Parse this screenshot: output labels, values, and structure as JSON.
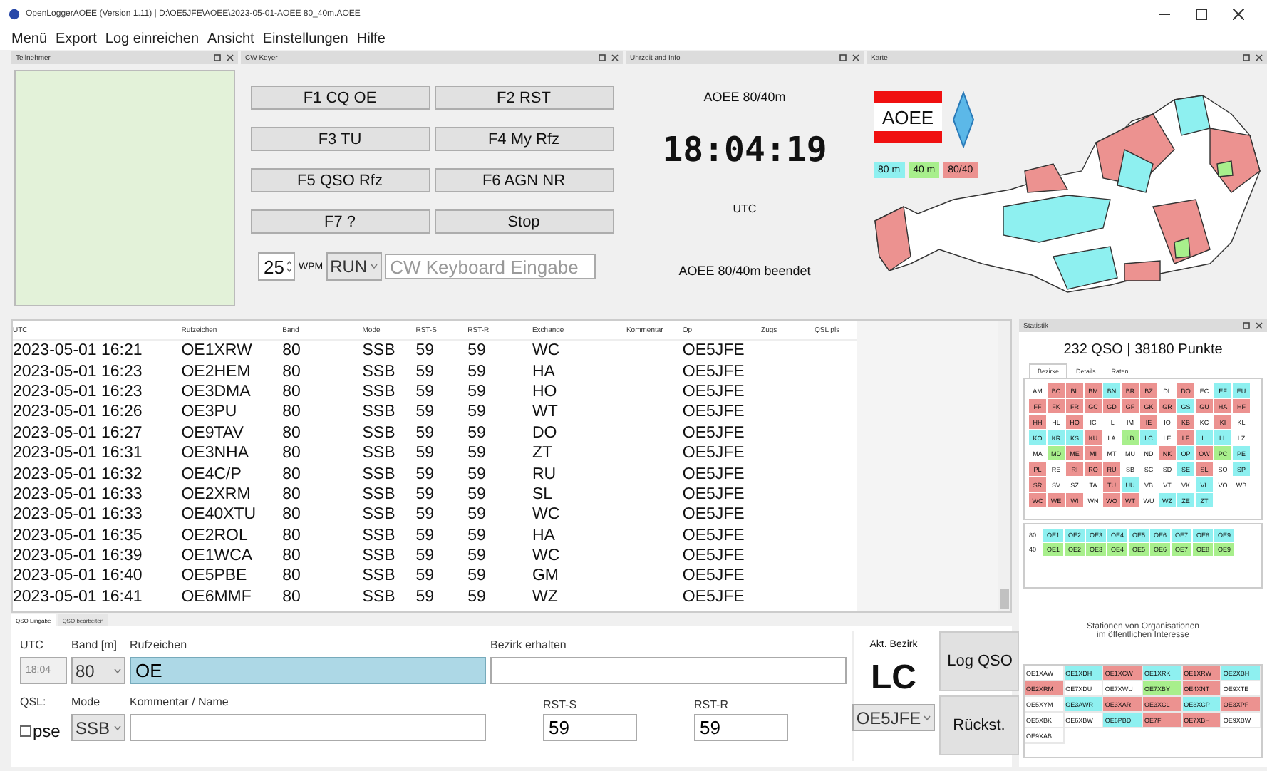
{
  "window": {
    "title": "OpenLoggerAOEE (Version 1.11) | D:\\OE5JFE\\AOEE\\2023-05-01-AOEE 80_40m.AOEE"
  },
  "menu": [
    "Menü",
    "Export",
    "Log einreichen",
    "Ansicht",
    "Einstellungen",
    "Hilfe"
  ],
  "participants_panel": {
    "title": "Teilnehmer"
  },
  "cw_keyer": {
    "title": "CW Keyer",
    "buttons": [
      "F1 CQ OE",
      "F2 RST",
      "F3 TU",
      "F4 My Rfz",
      "F5 QSO Rfz",
      "F6 AGN NR",
      "F7 ?",
      "Stop"
    ],
    "wpm": "25",
    "wpm_label": "WPM",
    "mode": "RUN",
    "placeholder": "CW Keyboard Eingabe"
  },
  "clock": {
    "title": "Uhrzeit and Info",
    "contest": "AOEE 80/40m",
    "time": "18:04:19",
    "zone": "UTC",
    "status": "AOEE 80/40m beendet"
  },
  "map": {
    "title": "Karte",
    "logo": "AOEE",
    "legend": [
      {
        "label": "80 m",
        "color": "#8ef0f0"
      },
      {
        "label": "40 m",
        "color": "#a8ef8c"
      },
      {
        "label": "80/40",
        "color": "#ec9290"
      }
    ]
  },
  "log_table": {
    "columns": [
      "UTC",
      "Rufzeichen",
      "Band",
      "Mode",
      "RST-S",
      "RST-R",
      "Exchange",
      "Kommentar",
      "Op",
      "Zugs",
      "QSL pls"
    ],
    "rows": [
      [
        "2023-05-01 16:21",
        "OE1XRW",
        "80",
        "SSB",
        "59",
        "59",
        "WC",
        "",
        "OE5JFE",
        "",
        ""
      ],
      [
        "2023-05-01 16:23",
        "OE2HEM",
        "80",
        "SSB",
        "59",
        "59",
        "HA",
        "",
        "OE5JFE",
        "",
        ""
      ],
      [
        "2023-05-01 16:23",
        "OE3DMA",
        "80",
        "SSB",
        "59",
        "59",
        "HO",
        "",
        "OE5JFE",
        "",
        ""
      ],
      [
        "2023-05-01 16:26",
        "OE3PU",
        "80",
        "SSB",
        "59",
        "59",
        "WT",
        "",
        "OE5JFE",
        "",
        ""
      ],
      [
        "2023-05-01 16:27",
        "OE9TAV",
        "80",
        "SSB",
        "59",
        "59",
        "DO",
        "",
        "OE5JFE",
        "",
        ""
      ],
      [
        "2023-05-01 16:31",
        "OE3NHA",
        "80",
        "SSB",
        "59",
        "59",
        "ZT",
        "",
        "OE5JFE",
        "",
        ""
      ],
      [
        "2023-05-01 16:32",
        "OE4C/P",
        "80",
        "SSB",
        "59",
        "59",
        "RU",
        "",
        "OE5JFE",
        "",
        ""
      ],
      [
        "2023-05-01 16:33",
        "OE2XRM",
        "80",
        "SSB",
        "59",
        "59",
        "SL",
        "",
        "OE5JFE",
        "",
        ""
      ],
      [
        "2023-05-01 16:33",
        "OE40XTU",
        "80",
        "SSB",
        "59",
        "59",
        "WC",
        "",
        "OE5JFE",
        "",
        ""
      ],
      [
        "2023-05-01 16:35",
        "OE2ROL",
        "80",
        "SSB",
        "59",
        "59",
        "HA",
        "",
        "OE5JFE",
        "",
        ""
      ],
      [
        "2023-05-01 16:39",
        "OE1WCA",
        "80",
        "SSB",
        "59",
        "59",
        "WC",
        "",
        "OE5JFE",
        "",
        ""
      ],
      [
        "2023-05-01 16:40",
        "OE5PBE",
        "80",
        "SSB",
        "59",
        "59",
        "GM",
        "",
        "OE5JFE",
        "",
        ""
      ],
      [
        "2023-05-01 16:41",
        "OE6MMF",
        "80",
        "SSB",
        "59",
        "59",
        "WZ",
        "",
        "OE5JFE",
        "",
        ""
      ]
    ]
  },
  "entry": {
    "tabs": [
      {
        "label": "QSO Eingabe",
        "selected": true
      },
      {
        "label": "QSO bearbeiten",
        "selected": false
      }
    ],
    "utc_label": "UTC",
    "utc_value": "18:04",
    "band_label": "Band [m]",
    "band_value": "80",
    "call_label": "Rufzeichen",
    "call_value": "OE",
    "district_label": "Bezirk erhalten",
    "qsl_label": "QSL:",
    "qsl_checkbox": {
      "label": "pse",
      "checked": false
    },
    "mode_label": "Mode",
    "mode_value": "SSB",
    "comment_label": "Kommentar / Name",
    "rsts_label": "RST-S",
    "rsts_value": "59",
    "rstr_label": "RST-R",
    "rstr_value": "59",
    "current_label": "Akt. Bezirk",
    "current_value": "LC",
    "operator": "OE5JFE",
    "log_button": "Log QSO",
    "reset_button": "Rückst."
  },
  "statistics": {
    "title": "Statistik",
    "summary": "232 QSO | 38180 Punkte",
    "tabs": [
      {
        "label": "Bezirke",
        "selected": true
      },
      {
        "label": "Details",
        "selected": false
      },
      {
        "label": "Raten",
        "selected": false
      }
    ],
    "districts": [
      {
        "code": "AM",
        "color": "#ffffff"
      },
      {
        "code": "BC",
        "color": "#ec9290"
      },
      {
        "code": "BL",
        "color": "#ec9290"
      },
      {
        "code": "BM",
        "color": "#ec9290"
      },
      {
        "code": "BN",
        "color": "#8ef0f0"
      },
      {
        "code": "BR",
        "color": "#ec9290"
      },
      {
        "code": "BZ",
        "color": "#ec9290"
      },
      {
        "code": "DL",
        "color": "#ffffff"
      },
      {
        "code": "DO",
        "color": "#ec9290"
      },
      {
        "code": "EC",
        "color": "#ffffff"
      },
      {
        "code": "EF",
        "color": "#8ef0f0"
      },
      {
        "code": "EU",
        "color": "#8ef0f0"
      },
      {
        "code": "FF",
        "color": "#ec9290"
      },
      {
        "code": "FK",
        "color": "#ec9290"
      },
      {
        "code": "FR",
        "color": "#ec9290"
      },
      {
        "code": "GC",
        "color": "#ec9290"
      },
      {
        "code": "GD",
        "color": "#ec9290"
      },
      {
        "code": "GF",
        "color": "#ec9290"
      },
      {
        "code": "GK",
        "color": "#ec9290"
      },
      {
        "code": "GR",
        "color": "#ec9290"
      },
      {
        "code": "GS",
        "color": "#8ef0f0"
      },
      {
        "code": "GU",
        "color": "#ec9290"
      },
      {
        "code": "HA",
        "color": "#ec9290"
      },
      {
        "code": "HF",
        "color": "#ec9290"
      },
      {
        "code": "HH",
        "color": "#ec9290"
      },
      {
        "code": "HL",
        "color": "#ffffff"
      },
      {
        "code": "HO",
        "color": "#ec9290"
      },
      {
        "code": "IC",
        "color": "#ffffff"
      },
      {
        "code": "IL",
        "color": "#ffffff"
      },
      {
        "code": "IM",
        "color": "#ffffff"
      },
      {
        "code": "IE",
        "color": "#ec9290"
      },
      {
        "code": "IO",
        "color": "#ffffff"
      },
      {
        "code": "KB",
        "color": "#ec9290"
      },
      {
        "code": "KC",
        "color": "#ffffff"
      },
      {
        "code": "KI",
        "color": "#ec9290"
      },
      {
        "code": "KL",
        "color": "#ffffff"
      },
      {
        "code": "KO",
        "color": "#8ef0f0"
      },
      {
        "code": "KR",
        "color": "#8ef0f0"
      },
      {
        "code": "KS",
        "color": "#8ef0f0"
      },
      {
        "code": "KU",
        "color": "#ec9290"
      },
      {
        "code": "LA",
        "color": "#ffffff"
      },
      {
        "code": "LB",
        "color": "#a8ef8c"
      },
      {
        "code": "LC",
        "color": "#8ef0f0"
      },
      {
        "code": "LE",
        "color": "#ffffff"
      },
      {
        "code": "LF",
        "color": "#ec9290"
      },
      {
        "code": "LI",
        "color": "#8ef0f0"
      },
      {
        "code": "LL",
        "color": "#8ef0f0"
      },
      {
        "code": "LZ",
        "color": "#ffffff"
      },
      {
        "code": "MA",
        "color": "#ffffff"
      },
      {
        "code": "MD",
        "color": "#a8ef8c"
      },
      {
        "code": "ME",
        "color": "#ec9290"
      },
      {
        "code": "MI",
        "color": "#ec9290"
      },
      {
        "code": "MT",
        "color": "#ffffff"
      },
      {
        "code": "MU",
        "color": "#ffffff"
      },
      {
        "code": "ND",
        "color": "#ffffff"
      },
      {
        "code": "NK",
        "color": "#ec9290"
      },
      {
        "code": "OP",
        "color": "#8ef0f0"
      },
      {
        "code": "OW",
        "color": "#ec9290"
      },
      {
        "code": "PC",
        "color": "#a8ef8c"
      },
      {
        "code": "PE",
        "color": "#8ef0f0"
      },
      {
        "code": "PL",
        "color": "#ec9290"
      },
      {
        "code": "RE",
        "color": "#ffffff"
      },
      {
        "code": "RI",
        "color": "#ec9290"
      },
      {
        "code": "RO",
        "color": "#ec9290"
      },
      {
        "code": "RU",
        "color": "#ec9290"
      },
      {
        "code": "SB",
        "color": "#ffffff"
      },
      {
        "code": "SC",
        "color": "#ffffff"
      },
      {
        "code": "SD",
        "color": "#ffffff"
      },
      {
        "code": "SE",
        "color": "#8ef0f0"
      },
      {
        "code": "SL",
        "color": "#ec9290"
      },
      {
        "code": "SO",
        "color": "#ffffff"
      },
      {
        "code": "SP",
        "color": "#8ef0f0"
      },
      {
        "code": "SR",
        "color": "#ec9290"
      },
      {
        "code": "SV",
        "color": "#ffffff"
      },
      {
        "code": "SZ",
        "color": "#ffffff"
      },
      {
        "code": "TA",
        "color": "#ffffff"
      },
      {
        "code": "TU",
        "color": "#ec9290"
      },
      {
        "code": "UU",
        "color": "#8ef0f0"
      },
      {
        "code": "VB",
        "color": "#ffffff"
      },
      {
        "code": "VT",
        "color": "#ffffff"
      },
      {
        "code": "VK",
        "color": "#ffffff"
      },
      {
        "code": "VL",
        "color": "#8ef0f0"
      },
      {
        "code": "VO",
        "color": "#ffffff"
      },
      {
        "code": "WB",
        "color": "#ffffff"
      },
      {
        "code": "WC",
        "color": "#ec9290"
      },
      {
        "code": "WE",
        "color": "#ec9290"
      },
      {
        "code": "WI",
        "color": "#ec9290"
      },
      {
        "code": "WN",
        "color": "#ffffff"
      },
      {
        "code": "WO",
        "color": "#ec9290"
      },
      {
        "code": "WT",
        "color": "#ec9290"
      },
      {
        "code": "WU",
        "color": "#ffffff"
      },
      {
        "code": "WZ",
        "color": "#8ef0f0"
      },
      {
        "code": "ZE",
        "color": "#8ef0f0"
      },
      {
        "code": "ZT",
        "color": "#8ef0f0"
      }
    ],
    "prefixes": [
      {
        "band": "80",
        "color": "#8ef0f0",
        "items": [
          "OE1",
          "OE2",
          "OE3",
          "OE4",
          "OE5",
          "OE6",
          "OE7",
          "OE8",
          "OE9"
        ]
      },
      {
        "band": "40",
        "color": "#a8ef8c",
        "items": [
          "OE1",
          "OE2",
          "OE3",
          "OE4",
          "OE5",
          "OE6",
          "OE7",
          "OE8",
          "OE9"
        ]
      }
    ],
    "stations_heading": "Stationen von Organisationen\nim öffentlichen Interesse",
    "stations": [
      {
        "call": "OE1XAW",
        "color": "#ffffff"
      },
      {
        "call": "OE1XDH",
        "color": "#8ef0f0"
      },
      {
        "call": "OE1XCW",
        "color": "#ec9290"
      },
      {
        "call": "OE1XRK",
        "color": "#8ef0f0"
      },
      {
        "call": "OE1XRW",
        "color": "#ec9290"
      },
      {
        "call": "OE2XBH",
        "color": "#8ef0f0"
      },
      {
        "call": "OE2XRM",
        "color": "#ec9290"
      },
      {
        "call": "OE7XDU",
        "color": "#ffffff"
      },
      {
        "call": "OE7XWU",
        "color": "#ffffff"
      },
      {
        "call": "OE7XBY",
        "color": "#a8ef8c"
      },
      {
        "call": "OE4XNT",
        "color": "#ec9290"
      },
      {
        "call": "OE9XTE",
        "color": "#ffffff"
      },
      {
        "call": "OE5XYM",
        "color": "#ffffff"
      },
      {
        "call": "OE3AWR",
        "color": "#8ef0f0"
      },
      {
        "call": "OE3XAR",
        "color": "#ec9290"
      },
      {
        "call": "OE3XCL",
        "color": "#ec9290"
      },
      {
        "call": "OE3XCP",
        "color": "#8ef0f0"
      },
      {
        "call": "OE3XPF",
        "color": "#ec9290"
      },
      {
        "call": "OE5XBK",
        "color": "#ffffff"
      },
      {
        "call": "OE6XBW",
        "color": "#ffffff"
      },
      {
        "call": "OE6PBD",
        "color": "#8ef0f0"
      },
      {
        "call": "OE7F",
        "color": "#ec9290"
      },
      {
        "call": "OE7XBH",
        "color": "#ec9290"
      },
      {
        "call": "OE9XBW",
        "color": "#ffffff"
      },
      {
        "call": "OE9XAB",
        "color": "#ffffff"
      }
    ]
  }
}
